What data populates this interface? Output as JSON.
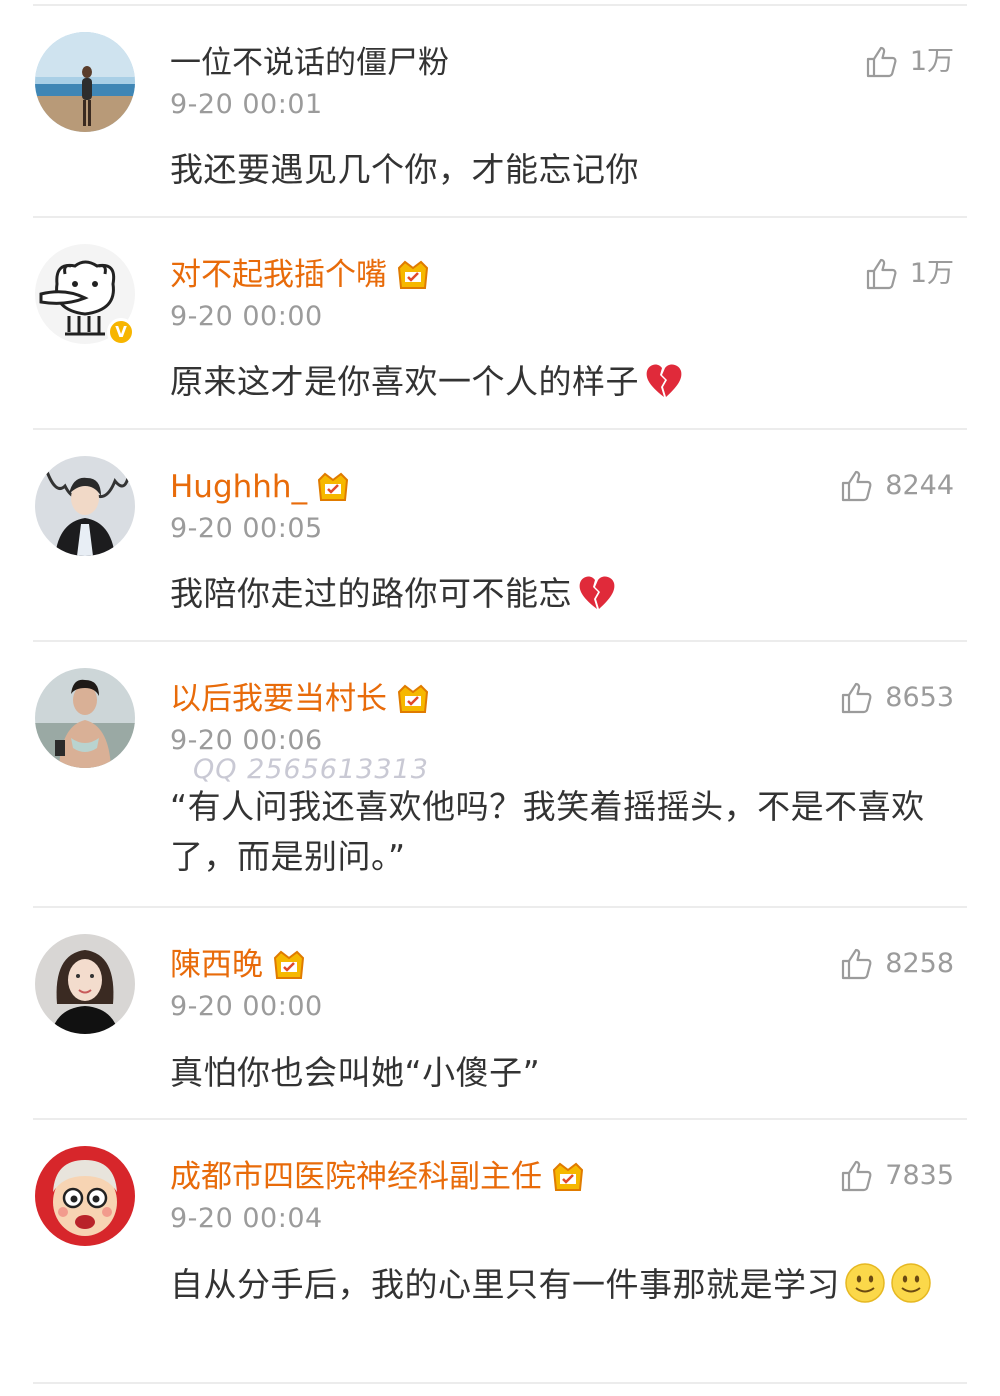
{
  "comments": [
    {
      "username": "一位不说话的僵尸粉",
      "time": "9-20 00:01",
      "likes": "1万",
      "text": "我还要遇见几个你，才能忘记你",
      "vip": false,
      "verified": false,
      "emoji": null
    },
    {
      "username": "对不起我插个嘴",
      "time": "9-20 00:00",
      "likes": "1万",
      "text": "原来这才是你喜欢一个人的样子",
      "vip": true,
      "verified": true,
      "emoji": "broken-heart"
    },
    {
      "username": "Hughhh_",
      "time": "9-20 00:05",
      "likes": "8244",
      "text": "我陪你走过的路你可不能忘",
      "vip": true,
      "verified": false,
      "emoji": "broken-heart"
    },
    {
      "username": "以后我要当村长",
      "time": "9-20 00:06",
      "likes": "8653",
      "text": "“有人问我还喜欢他吗？我笑着摇摇头，不是不喜欢了，而是别问。”",
      "vip": true,
      "verified": false,
      "emoji": null
    },
    {
      "username": "陳西晚",
      "time": "9-20 00:00",
      "likes": "8258",
      "text": "真怕你也会叫她“小傻子”",
      "vip": true,
      "verified": false,
      "emoji": null
    },
    {
      "username": "成都市四医院神经科副主任",
      "time": "9-20 00:04",
      "likes": "7835",
      "text": "自从分手后，我的心里只有一件事那就是学习",
      "vip": true,
      "verified": false,
      "emoji": "smiley-double"
    }
  ],
  "watermark": "QQ 2565613313",
  "colors": {
    "vip_name": "#e86b0a",
    "plain_name": "#333333",
    "meta": "#9b9b9b",
    "divider": "#ececec",
    "badge": "#f7b500"
  }
}
